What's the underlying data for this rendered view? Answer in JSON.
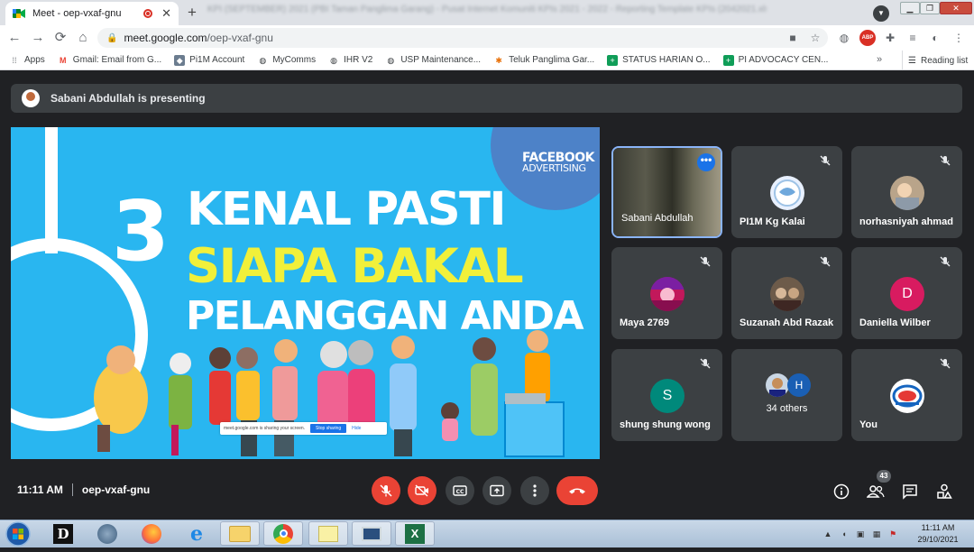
{
  "browser": {
    "tab_title": "Meet - oep-vxaf-gnu",
    "tab_close": "✕",
    "new_tab": "+",
    "background_tab_text": "KPI (SEPTEMBER) 2021 (PBI Taman Panglima Garang) - Pusat Internet Komuniti KPIs 2021 - 2022 - Reporting Template KPIs (2042021.xls) - Microsoft Excel",
    "url_host": "meet.google.com",
    "url_path": "/oep-vxaf-gnu",
    "window_buttons": {
      "minimize": "▁",
      "restore": "❐",
      "close": "✕"
    }
  },
  "bookmarks": {
    "items": [
      {
        "label": "Apps",
        "icon": "apps-grid-icon",
        "color": "#5f6368"
      },
      {
        "label": "Gmail: Email from G...",
        "icon": "gmail-icon",
        "color": "#ea4335"
      },
      {
        "label": "Pi1M Account",
        "icon": "pi1m-icon",
        "color": "#6b7c8f"
      },
      {
        "label": "MyComms",
        "icon": "globe-icon",
        "color": "#3c4043"
      },
      {
        "label": "IHR V2",
        "icon": "globe-icon",
        "color": "#3c4043"
      },
      {
        "label": "USP Maintenance...",
        "icon": "globe-icon",
        "color": "#3c4043"
      },
      {
        "label": "Teluk Panglima Gar...",
        "icon": "pinwheel-icon",
        "color": "#e8710a"
      },
      {
        "label": "STATUS HARIAN O...",
        "icon": "sheets-icon",
        "color": "#0f9d58"
      },
      {
        "label": "PI ADVOCACY CEN...",
        "icon": "sheets-icon",
        "color": "#0f9d58"
      }
    ],
    "more": "»",
    "reading_list": "Reading list"
  },
  "meet": {
    "presenting_text": "Sabani Abdullah is presenting",
    "slide": {
      "badge_line1": "FACEBOOK",
      "badge_line2": "ADVERTISING",
      "number": "3",
      "line1": "KENAL PASTI",
      "line2": "SIAPA BAKAL",
      "line3": "PELANGGAN ANDA",
      "share_text": "meet.google.com is sharing your screen.",
      "stop_sharing": "Stop sharing",
      "hide": "Hide"
    },
    "participants": [
      {
        "name": "Sabani Abdullah",
        "type": "camera",
        "more": "•••"
      },
      {
        "name": "PI1M Kg Kalai",
        "type": "image",
        "avatar_color": "#e8f0fe"
      },
      {
        "name": "norhasniyah ahmad",
        "type": "image",
        "avatar_color": "#b9a48a"
      },
      {
        "name": "Maya 2769",
        "type": "image",
        "avatar_color": "#c2185b"
      },
      {
        "name": "Suzanah Abd Razak",
        "type": "image",
        "avatar_color": "#6d5b4a"
      },
      {
        "name": "Daniella Wilber",
        "type": "letter",
        "letter": "D",
        "avatar_color": "#d81b60"
      },
      {
        "name": "shung shung wong",
        "type": "letter",
        "letter": "S",
        "avatar_color": "#00897b"
      },
      {
        "name": "34 others",
        "type": "others",
        "letter": "H"
      },
      {
        "name": "You",
        "type": "image",
        "avatar_color": "#ffffff"
      }
    ],
    "time": "11:11 AM",
    "meeting_code": "oep-vxaf-gnu",
    "people_count": "43"
  },
  "taskbar": {
    "clock_time": "11:11 AM",
    "clock_date": "29/10/2021"
  }
}
